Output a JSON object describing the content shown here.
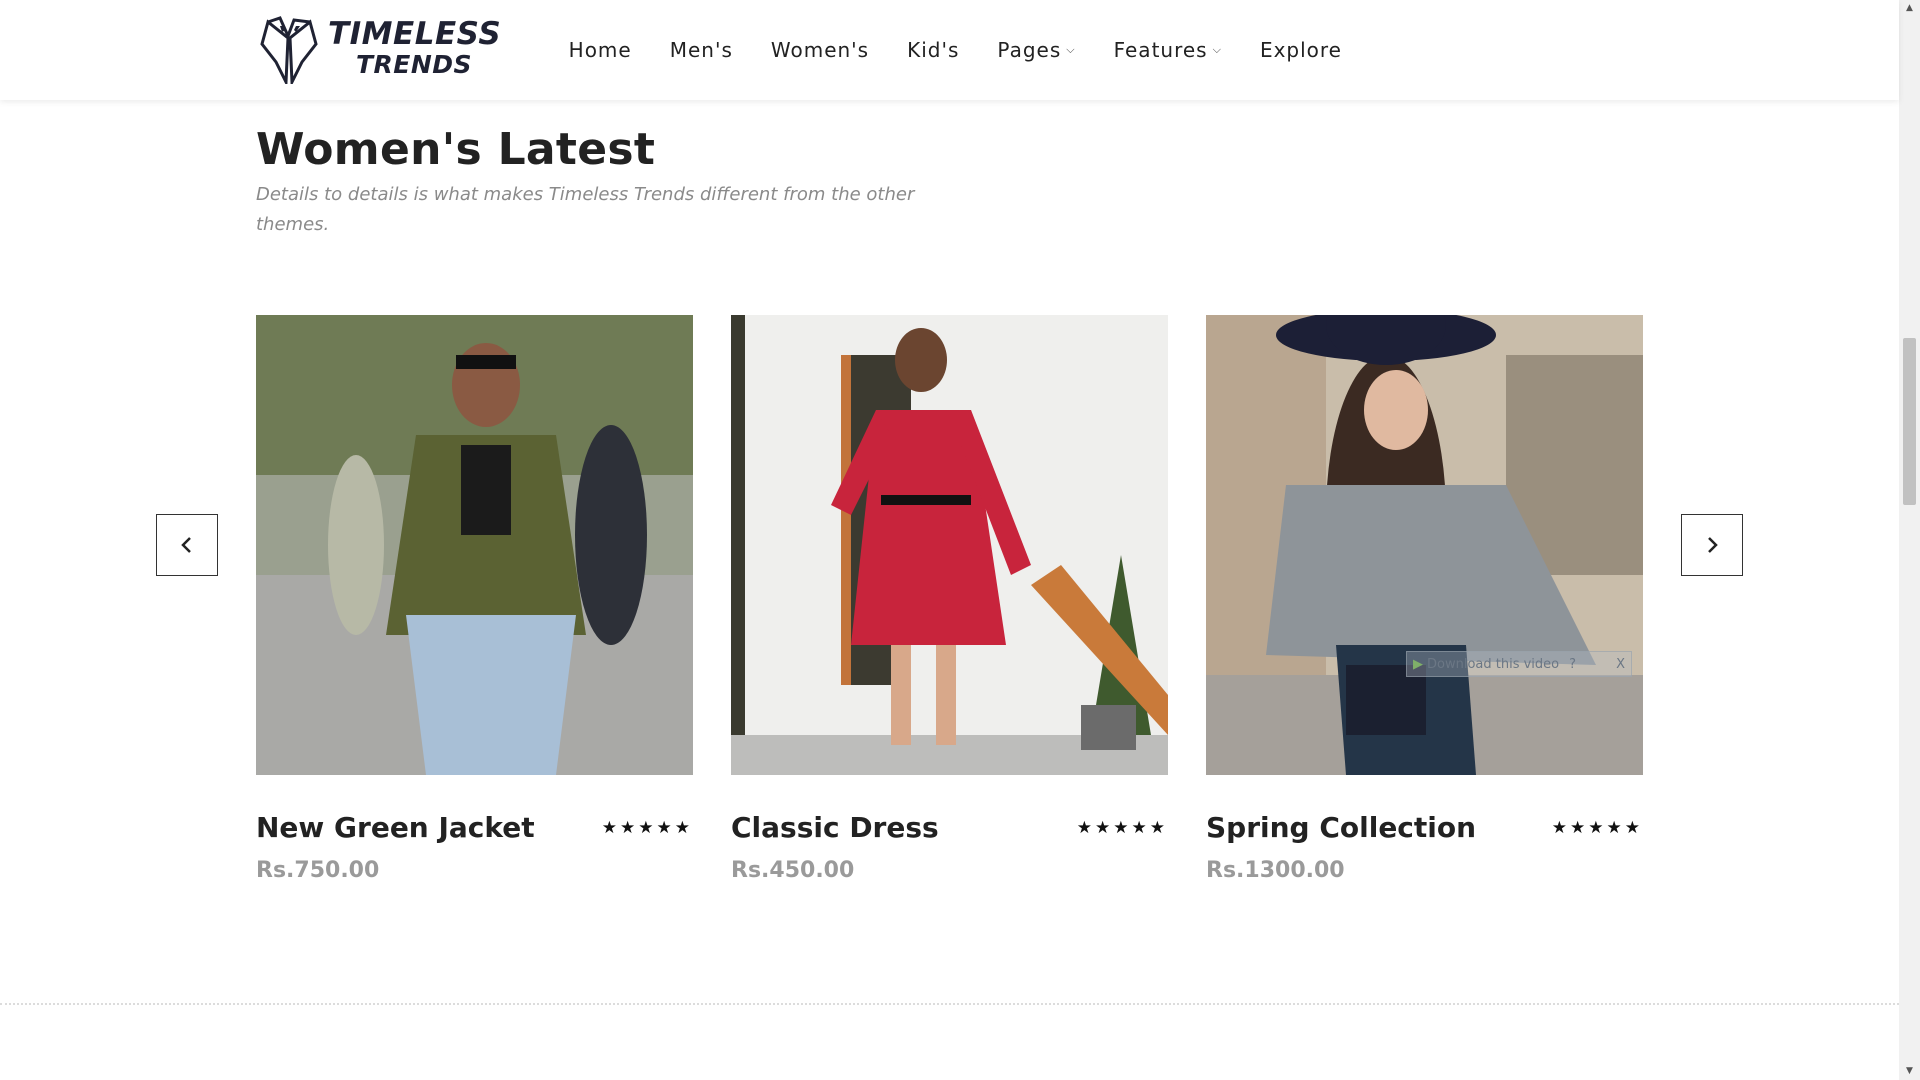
{
  "brand": {
    "line1": "TIMELESS",
    "line2": "TRENDS",
    "logo_icon": "tuxedo-lapel-icon"
  },
  "nav": {
    "items": [
      {
        "label": "Home"
      },
      {
        "label": "Men's"
      },
      {
        "label": "Women's"
      },
      {
        "label": "Kid's"
      },
      {
        "label": "Pages",
        "dropdown": true
      },
      {
        "label": "Features",
        "dropdown": true
      },
      {
        "label": "Explore"
      }
    ]
  },
  "section": {
    "title": "Women's Latest",
    "subtitle": "Details to details is what makes Timeless Trends different from the other themes."
  },
  "carousel": {
    "prev_icon": "chevron-left-icon",
    "next_icon": "chevron-right-icon",
    "products": [
      {
        "name": "New Green Jacket",
        "price": "Rs.750.00",
        "rating": 5,
        "stars": "★★★★★"
      },
      {
        "name": "Classic Dress",
        "price": "Rs.450.00",
        "rating": 5,
        "stars": "★★★★★"
      },
      {
        "name": "Spring Collection",
        "price": "Rs.1300.00",
        "rating": 5,
        "stars": "★★★★★"
      }
    ]
  },
  "overlay": {
    "download_label": "Download this video",
    "help": "?",
    "close": "X"
  },
  "colors": {
    "text": "#222222",
    "muted": "#9a9a9a",
    "logo": "#1f2233"
  }
}
